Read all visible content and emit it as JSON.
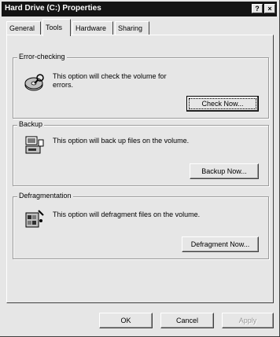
{
  "window": {
    "title": "Hard Drive (C:) Properties",
    "help_label": "?",
    "close_label": "×"
  },
  "tabs": [
    {
      "label": "General"
    },
    {
      "label": "Tools"
    },
    {
      "label": "Hardware"
    },
    {
      "label": "Sharing"
    }
  ],
  "active_tab": "Tools",
  "sections": {
    "error_checking": {
      "legend": "Error-checking",
      "line1": "This option will check the volume for",
      "line2": "errors.",
      "button": "Check Now..."
    },
    "backup": {
      "legend": "Backup",
      "description": "This option will back up files on the volume.",
      "button": "Backup Now..."
    },
    "defragmentation": {
      "legend": "Defragmentation",
      "description": "This option will defragment files on the volume.",
      "button": "Defragment Now..."
    }
  },
  "footer": {
    "ok": "OK",
    "cancel": "Cancel",
    "apply": "Apply"
  },
  "icons": {
    "error_checking": "disk-check-icon",
    "backup": "backup-icon",
    "defrag": "defragment-icon"
  },
  "colors": {
    "titlebar": "#141414",
    "dialog": "#e6e6e6",
    "disabled_text": "#9a9a9a"
  }
}
